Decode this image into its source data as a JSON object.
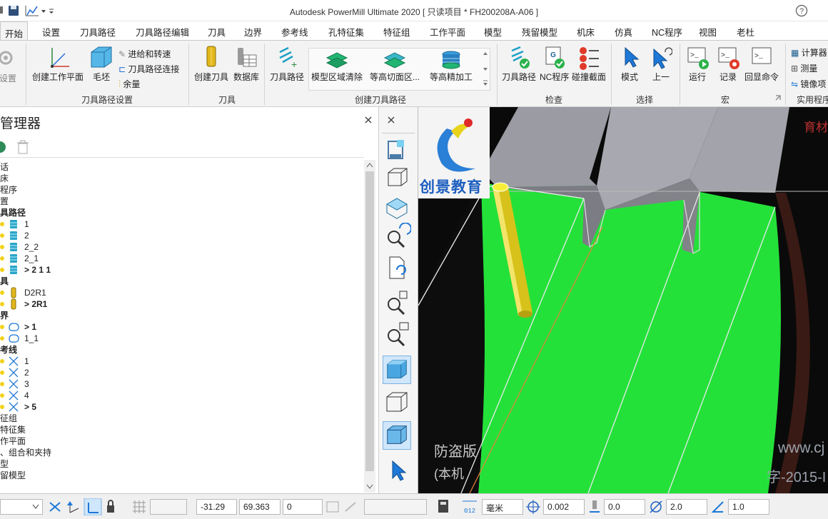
{
  "window": {
    "title": "Autodesk PowerMill Ultimate 2020   [ 只读项目 * FH200208A-A06 ]"
  },
  "tabs": [
    "开始",
    "设置",
    "刀具路径",
    "刀具路径编辑",
    "刀具",
    "边界",
    "参考线",
    "孔特征集",
    "特征组",
    "工作平面",
    "模型",
    "残留模型",
    "机床",
    "仿真",
    "NC程序",
    "视图",
    "老杜"
  ],
  "ribbon": {
    "setup_label": "设置",
    "create_workplane": "创建工作平面",
    "block": "毛坯",
    "feeds_speeds": "进给和转速",
    "toolpath_connections": "刀具路径连接",
    "thickness": "余量",
    "group_toolpath_setup": "刀具路径设置",
    "create_tool": "创建刀具",
    "database": "数据库",
    "group_tool": "刀具",
    "toolpath_btn": "刀具路径",
    "model_area_clearance": "模型区域清除",
    "z_level_slice": "等高切面区...",
    "constant_z_finish": "等高精加工",
    "group_create_toolpath": "创建刀具路径",
    "check_toolpath": "刀具路径",
    "check_nc": "NC程序",
    "collision_section": "碰撞截面",
    "group_check": "检查",
    "mode": "模式",
    "previous": "上一",
    "group_select": "选择",
    "run": "运行",
    "record": "记录",
    "echo_commands": "回显命令",
    "group_macro": "宏",
    "calculator": "计算器",
    "measure": "测量",
    "mirror": "镜像项",
    "group_utilities": "实用程序"
  },
  "explorer": {
    "title": "管理器",
    "items": [
      {
        "text": "话",
        "bold": false,
        "icon": "none"
      },
      {
        "text": "床",
        "bold": false,
        "icon": "none"
      },
      {
        "text": "程序",
        "bold": false,
        "icon": "none"
      },
      {
        "text": "置",
        "bold": false,
        "icon": "none"
      },
      {
        "text": "具路径",
        "bold": true,
        "icon": "none"
      },
      {
        "text": "1",
        "bold": false,
        "icon": "toolpath"
      },
      {
        "text": "2",
        "bold": false,
        "icon": "toolpath"
      },
      {
        "text": "2_2",
        "bold": false,
        "icon": "toolpath"
      },
      {
        "text": "2_1",
        "bold": false,
        "icon": "toolpath"
      },
      {
        "text": "> 2 1 1",
        "bold": true,
        "icon": "toolpath"
      },
      {
        "text": "具",
        "bold": true,
        "icon": "none"
      },
      {
        "text": "D2R1",
        "bold": false,
        "icon": "tool"
      },
      {
        "text": "> 2R1",
        "bold": true,
        "icon": "tool"
      },
      {
        "text": "界",
        "bold": true,
        "icon": "none"
      },
      {
        "text": "> 1",
        "bold": true,
        "icon": "boundary"
      },
      {
        "text": "1_1",
        "bold": false,
        "icon": "boundary"
      },
      {
        "text": "考线",
        "bold": true,
        "icon": "none"
      },
      {
        "text": "1",
        "bold": false,
        "icon": "pattern"
      },
      {
        "text": "2",
        "bold": false,
        "icon": "pattern"
      },
      {
        "text": "3",
        "bold": false,
        "icon": "pattern"
      },
      {
        "text": "4",
        "bold": false,
        "icon": "pattern"
      },
      {
        "text": "> 5",
        "bold": true,
        "icon": "pattern"
      },
      {
        "text": "征组",
        "bold": false,
        "icon": "none"
      },
      {
        "text": "特征集",
        "bold": false,
        "icon": "none"
      },
      {
        "text": "作平面",
        "bold": false,
        "icon": "none"
      },
      {
        "text": "、组合和夹持",
        "bold": false,
        "icon": "none"
      },
      {
        "text": "型",
        "bold": false,
        "icon": "none"
      },
      {
        "text": "留模型",
        "bold": false,
        "icon": "none"
      }
    ]
  },
  "viewport": {
    "watermark_brand": "创景教育",
    "watermark_antipiracy": "防盗版",
    "watermark_note": "(本机",
    "watermark_url": "www.cj",
    "watermark_license": "字-2015-I",
    "watermark_corner": "育材"
  },
  "status": {
    "x": "-31.29",
    "y": "69.363",
    "z": "0",
    "units": "毫米",
    "tolerance": "0.002",
    "thickness": "0.0",
    "diameter": "2.0",
    "stepover": "1.0"
  },
  "colors": {
    "ribbon_bg": "#f3f3f3",
    "model_green": "#22e03a",
    "tool_yellow": "#d8c21a",
    "wall_grey": "#9a9aa2"
  }
}
